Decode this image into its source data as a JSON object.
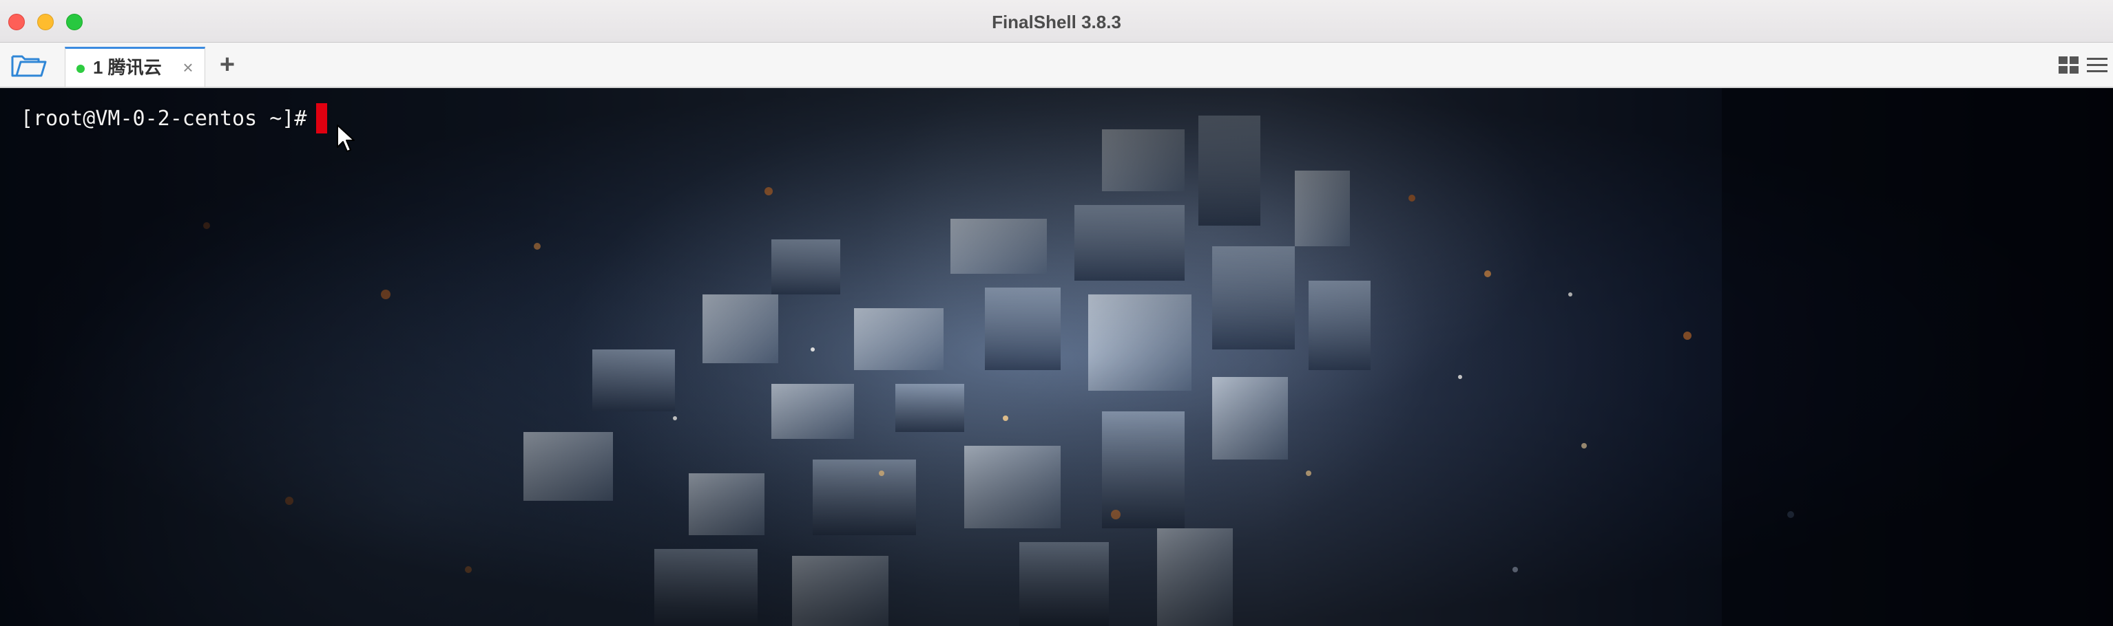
{
  "window": {
    "title": "FinalShell 3.8.3"
  },
  "tabs": [
    {
      "label": "1 腾讯云",
      "status": "connected",
      "status_color": "#2ecc40",
      "close_glyph": "×"
    }
  ],
  "toolbar": {
    "open_icon": "folder-open-icon",
    "add_tab_glyph": "+",
    "layout_icons": [
      "grid-view-icon",
      "list-view-icon"
    ]
  },
  "terminal": {
    "prompt": "[root@VM-0-2-centos ~]# ",
    "cursor_color": "#e00010"
  },
  "colors": {
    "accent": "#3b8be0",
    "traffic_close": "#fe5f57",
    "traffic_min": "#febc2e",
    "traffic_max": "#28c840"
  }
}
